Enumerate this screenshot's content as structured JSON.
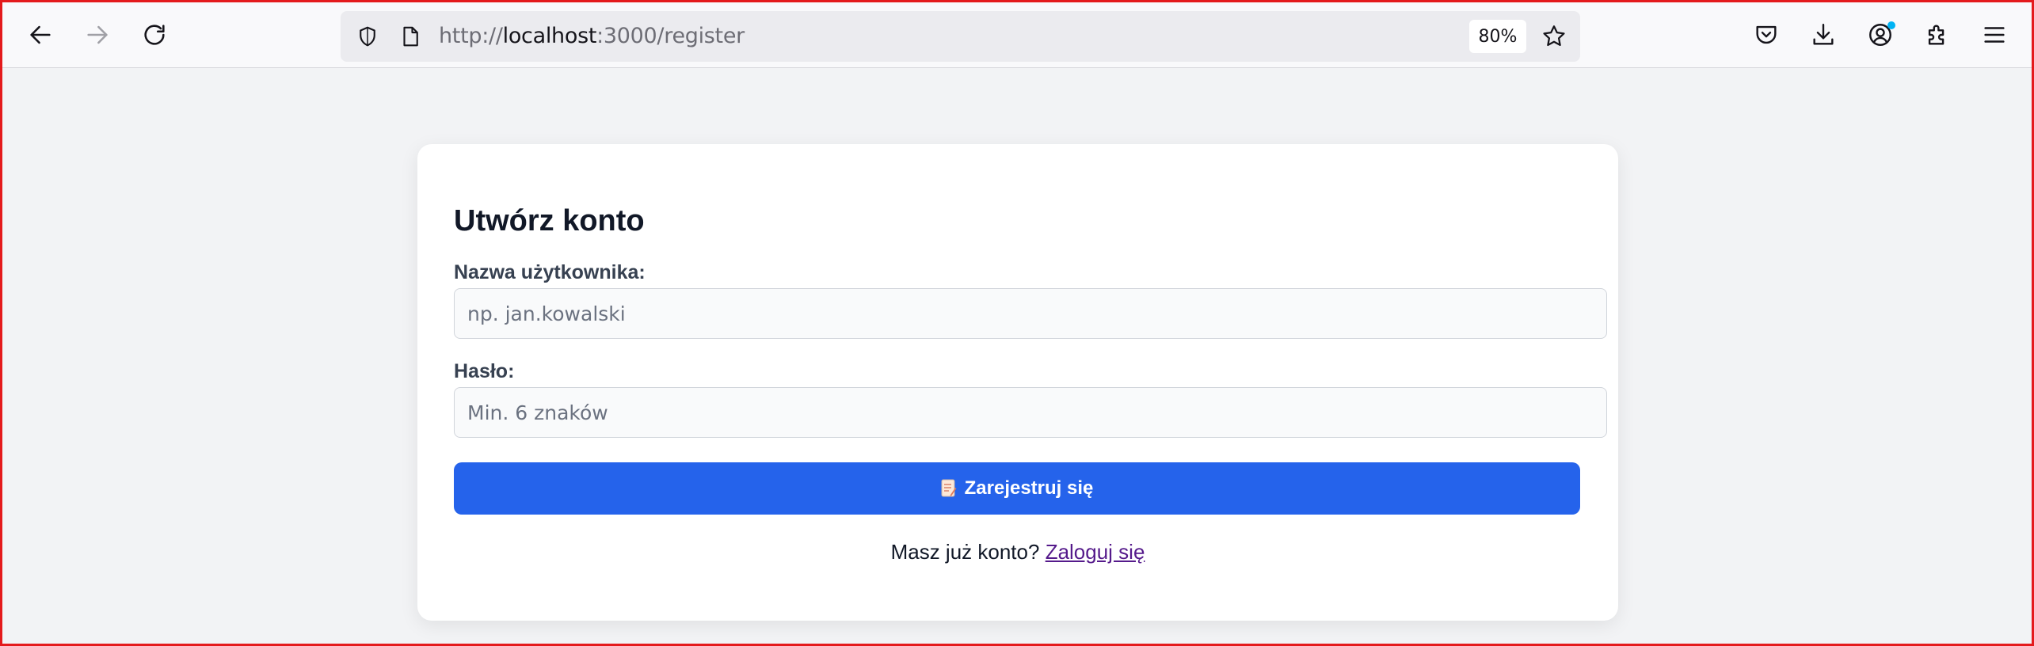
{
  "browser": {
    "url_scheme": "http://",
    "url_host": "localhost",
    "url_path": ":3000/register",
    "zoom": "80%",
    "icons": [
      "back-icon",
      "forward-icon",
      "reload-icon",
      "shield-icon",
      "page-icon",
      "bookmark-star-icon",
      "pocket-icon",
      "download-icon",
      "account-icon",
      "extensions-icon",
      "menu-icon"
    ],
    "accent_dot_color": "#00b3f4"
  },
  "form": {
    "title": "Utwórz konto",
    "username_label": "Nazwa użytkownika:",
    "username_placeholder": "np. jan.kowalski",
    "username_value": "",
    "password_label": "Hasło:",
    "password_placeholder": "Min. 6 znaków",
    "password_value": "",
    "submit_label": "Zarejestruj się",
    "submit_icon": "memo-icon",
    "submit_color": "#2563eb",
    "login_prompt": "Masz już konto?",
    "login_link": "Zaloguj się"
  }
}
